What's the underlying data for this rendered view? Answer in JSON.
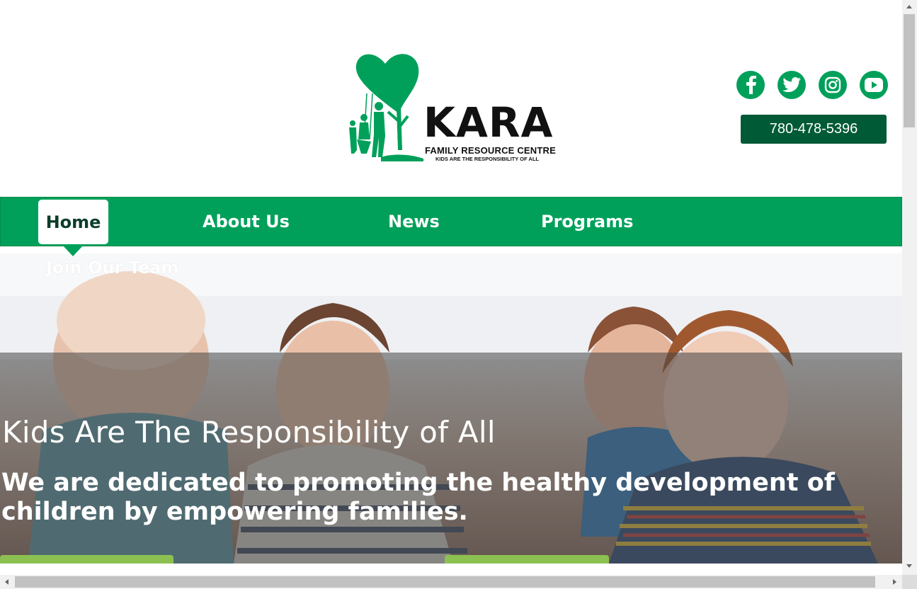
{
  "logo": {
    "name": "KARA",
    "subtitle": "FAMILY RESOURCE CENTRE",
    "tagline": "KIDS ARE THE RESPONSIBILITY OF ALL"
  },
  "social": {
    "icons": [
      "facebook-icon",
      "twitter-icon",
      "instagram-icon",
      "youtube-icon"
    ]
  },
  "phone": "780-478-5396",
  "nav": {
    "home": "Home",
    "about": "About Us",
    "news": "News",
    "programs": "Programs",
    "join": "Join Our Team"
  },
  "hero": {
    "title": "Kids Are The Responsibility of All",
    "subtitle": "We are dedicated to promoting the healthy development of children by empowering families."
  },
  "colors": {
    "brand_green": "#00a05a",
    "dark_green": "#005a35",
    "cta_green": "#8cc152"
  }
}
